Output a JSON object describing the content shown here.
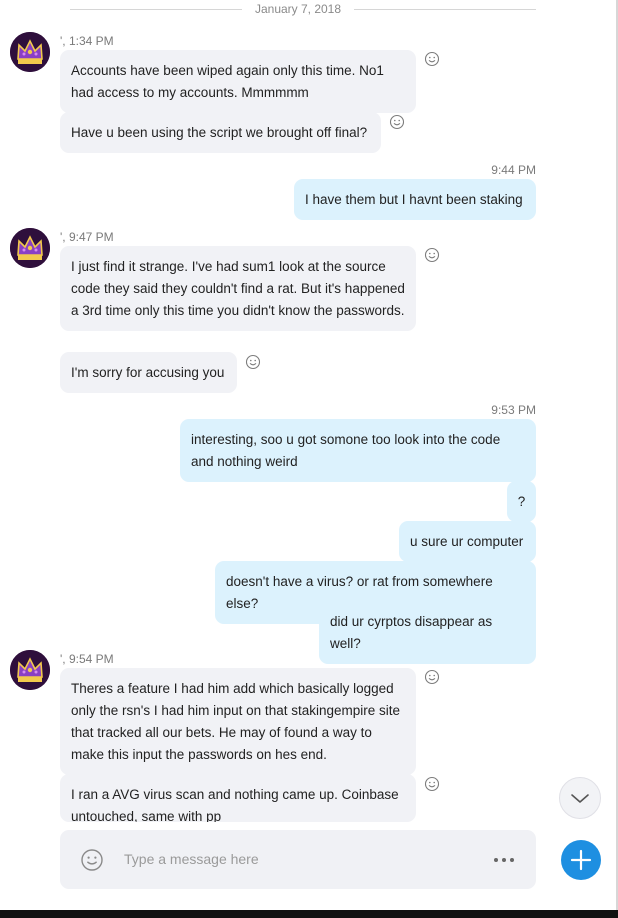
{
  "date_separator": "January 7, 2018",
  "groups": [
    {
      "direction": "incoming",
      "time": "', 1:34 PM",
      "messages": [
        "Accounts have been wiped again only this time. No1 had access to my accounts. Mmmmmm",
        "Have u been using the script we brought off final?"
      ]
    },
    {
      "direction": "outgoing",
      "time": "9:44 PM",
      "messages": [
        "I have them but I havnt been staking"
      ]
    },
    {
      "direction": "incoming",
      "time": "', 9:47 PM",
      "messages": [
        "I just find it strange. I've had sum1 look at the source code they said they couldn't find a rat. But it's happened a 3rd time only this time you didn't know the passwords.",
        "I'm sorry for accusing you"
      ]
    },
    {
      "direction": "outgoing",
      "time": "9:53 PM",
      "messages": [
        "interesting, soo u got somone too look into the code and nothing weird",
        "?",
        "u sure ur computer",
        "doesn't have a virus? or rat from somewhere else?",
        "did ur cyrptos disappear as well?"
      ]
    },
    {
      "direction": "incoming",
      "time": "', 9:54 PM",
      "messages": [
        "Theres a feature I had him add which basically logged only the rsn's I had him input on that stakingempire site that tracked all our bets. He may of found a way to make this input the passwords on hes end.",
        "I ran a AVG virus scan and nothing came up. Coinbase untouched, same with pp"
      ]
    }
  ],
  "composer": {
    "placeholder": "Type a message here"
  },
  "icons": {
    "avatar": "crown-avatar-icon",
    "reaction": "smiley-icon",
    "composer_emoji": "smiley-icon",
    "more": "more-dots-icon",
    "scroll": "chevron-down-icon",
    "new": "plus-icon"
  },
  "colors": {
    "incoming_bubble": "#f1f2f6",
    "outgoing_bubble": "#dcf2fd",
    "accent": "#1e8fe1"
  }
}
